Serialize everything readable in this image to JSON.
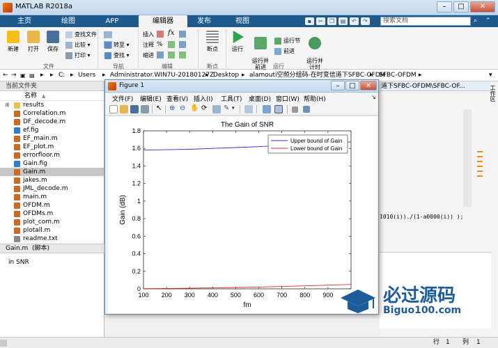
{
  "window": {
    "title": "MATLAB R2018a"
  },
  "tabs": [
    "主页",
    "绘图",
    "APP",
    "编辑器",
    "发布",
    "视图"
  ],
  "active_tab": "编辑器",
  "search": {
    "placeholder": "搜索文档"
  },
  "ribbon": {
    "new": "新建",
    "open": "打开",
    "save": "保存",
    "find_files": "查找文件",
    "compare": "比较",
    "print": "打印",
    "goto": "转至",
    "find": "查找",
    "insert": "插入",
    "comment": "注释",
    "indent": "缩进",
    "breakpoints": "断点",
    "run": "运行",
    "run_advance": "运行并\n前进",
    "run_section": "运行节",
    "advance": "前进",
    "run_time": "运行并\n计时",
    "groups": {
      "file": "文件",
      "nav": "导航",
      "edit": "编辑",
      "breakpoints": "断点",
      "run": "运行"
    }
  },
  "address": {
    "parts": [
      "C:",
      "Users",
      "Administrator.WIN7U-20180127Z",
      "Desktop",
      "alamouti空频分组码-在时变信道下SFBC-OFDM",
      "SFBC-OFDM"
    ]
  },
  "current_folder": {
    "title": "当前文件夹",
    "column": "名称",
    "sort_arrow": "▲",
    "items": [
      "results",
      "Correlation.m",
      "DF_decode.m",
      "ef.fig",
      "EF_main.m",
      "EF_plot.m",
      "errorfloor.m",
      "Gain.fig",
      "Gain.m",
      "jakes.m",
      "JML_decode.m",
      "main.m",
      "OFDM.m",
      "OFDMs.m",
      "plot_com.m",
      "plotall.m",
      "readme.txt"
    ],
    "selected": "Gain.m"
  },
  "details": {
    "title": "Gain.m  (脚本)",
    "text": "in SNR"
  },
  "editor_fragments": {
    "path": "道下SFBC-OFDM\\SFBC-OF...",
    "code": "1010(i)).∕(1-a0000(i)) );"
  },
  "workspace_label": "工作区",
  "figure": {
    "title": "Figure 1",
    "menu": [
      "文件(F)",
      "编辑(E)",
      "查看(V)",
      "插入(I)",
      "工具(T)",
      "桌面(D)",
      "窗口(W)",
      "帮助(H)"
    ]
  },
  "watermark": {
    "cn": "必过源码",
    "url": "Biguo100.com"
  },
  "status": {
    "row_label": "行",
    "row": "1",
    "col_label": "列",
    "col": "1"
  },
  "colors": {
    "upper": "#2b2bd8",
    "lower": "#d82b2b",
    "tabbar": "#1e5b8c"
  },
  "chart_data": {
    "type": "line",
    "title": "The Gain of SNR",
    "xlabel": "fm",
    "ylabel": "Gain (dB)",
    "xlim": [
      100,
      1000
    ],
    "ylim": [
      0,
      1.8
    ],
    "xticks": [
      100,
      200,
      300,
      400,
      500,
      600,
      700,
      800,
      900
    ],
    "yticks": [
      0,
      0.2,
      0.4,
      0.6,
      0.8,
      1,
      1.2,
      1.4,
      1.6,
      1.8
    ],
    "legend_position": "top-right",
    "series": [
      {
        "name": "Upper bound of Gain",
        "color": "#2b2bd8",
        "x": [
          100,
          200,
          300,
          400,
          500,
          600,
          700,
          800,
          900,
          1000
        ],
        "y": [
          1.58,
          1.585,
          1.59,
          1.6,
          1.61,
          1.62,
          1.635,
          1.645,
          1.66,
          1.675
        ]
      },
      {
        "name": "Lower bound of Gain",
        "color": "#d82b2b",
        "x": [
          100,
          200,
          300,
          400,
          500,
          600,
          700,
          800,
          900,
          1000
        ],
        "y": [
          0.002,
          0.004,
          0.007,
          0.011,
          0.016,
          0.021,
          0.027,
          0.034,
          0.042,
          0.05
        ]
      }
    ]
  }
}
